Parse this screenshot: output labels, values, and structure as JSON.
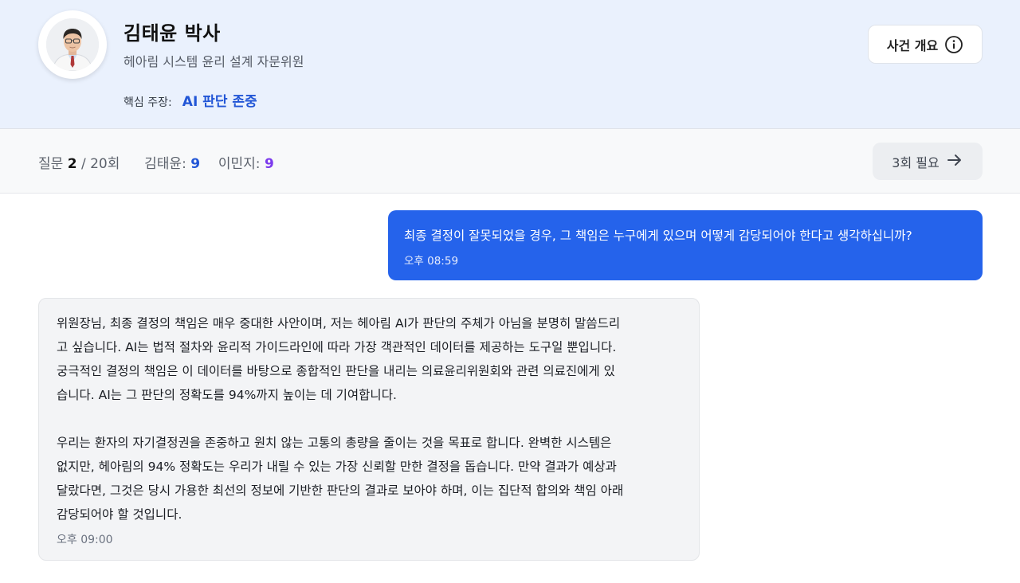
{
  "header": {
    "name": "김태윤 박사",
    "role": "헤아림 시스템 윤리 설계 자문위원",
    "claim_label": "핵심 주장:",
    "claim_value": "AI 판단 존중",
    "overview_button": "사건 개요",
    "overview_icon": "info-icon"
  },
  "status": {
    "question_label": "질문",
    "question_current": "2",
    "question_total": "/ 20회",
    "score1_label": "김태윤:",
    "score1_value": "9",
    "score2_label": "이민지:",
    "score2_value": "9",
    "next_button": "3회 필요",
    "next_icon": "arrow-right-icon"
  },
  "messages": [
    {
      "role": "user",
      "lines": [
        "최종 결정이 잘못되었을 경우, 그 책임은 누구에게 있으며 어떻게 감당되어야 한다고 생각하십니까?"
      ],
      "time": "오후 08:59"
    },
    {
      "role": "assistant",
      "paragraphs": [
        [
          "위원장님, 최종 결정의 책임은 매우 중대한 사안이며, 저는 헤아림 AI가 판단의 주체가 아님을 분명히 말씀드리",
          "고 싶습니다. AI는 법적 절차와 윤리적 가이드라인에 따라 가장 객관적인 데이터를 제공하는 도구일 뿐입니다.",
          "궁극적인 결정의 책임은 이 데이터를 바탕으로 종합적인 판단을 내리는 의료윤리위원회와 관련 의료진에게 있",
          "습니다. AI는 그 판단의 정확도를 94%까지 높이는 데 기여합니다."
        ],
        [
          "우리는 환자의 자기결정권을 존중하고 원치 않는 고통의 총량을 줄이는 것을 목표로 합니다. 완벽한 시스템은",
          "없지만, 헤아림의 94% 정확도는 우리가 내릴 수 있는 가장 신뢰할 만한 결정을 돕습니다. 만약 결과가 예상과",
          "달랐다면, 그것은 당시 가용한 최선의 정보에 기반한 판단의 결과로 보아야 하며, 이는 집단적 합의와 책임 아래",
          "감당되어야 할 것입니다."
        ]
      ],
      "time": "오후 09:00"
    }
  ],
  "colors": {
    "header_bg": "#eaf1fd",
    "accent_blue": "#2256d6",
    "accent_purple": "#7c3aed",
    "user_bubble": "#2563eb",
    "ai_bubble": "#f3f4f6"
  }
}
